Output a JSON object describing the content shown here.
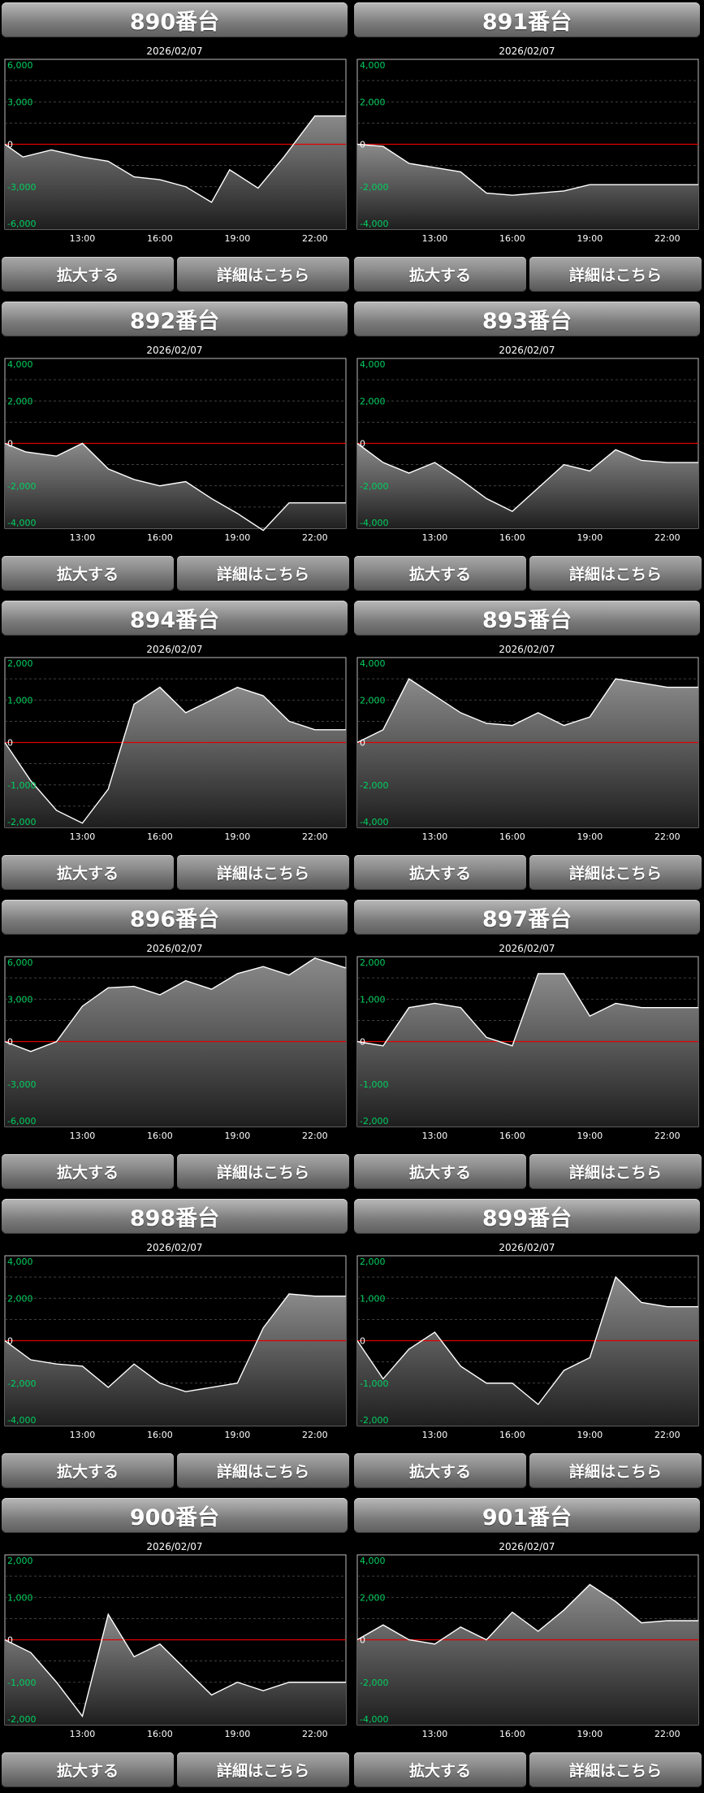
{
  "buttons": {
    "zoom_label": "拡大する",
    "detail_label": "詳細はこちら"
  },
  "colors": {
    "zero_line": "#e00000",
    "axis_label": "#00d060",
    "line": "#ffffff"
  },
  "panels": [
    {
      "title": "890番台",
      "date": "2026/02/07",
      "chart_data": {
        "type": "area",
        "y_ticks": [
          "6,000",
          "3,000",
          "0",
          "-3,000",
          "-6,000"
        ],
        "y_tick_values": [
          6000,
          3000,
          0,
          -3000,
          -6000
        ],
        "ylim": [
          -6000,
          6000
        ],
        "x_ticks": [
          "13:00",
          "16:00",
          "19:00",
          "22:00"
        ],
        "x_tick_values": [
          13,
          16,
          19,
          22
        ],
        "xlim": [
          10,
          23.2
        ],
        "x": [
          10,
          10.7,
          11.8,
          13,
          14,
          15,
          16,
          17,
          18,
          18.7,
          19.8,
          20.8,
          22,
          23,
          23.2
        ],
        "y": [
          0,
          -900,
          -400,
          -900,
          -1200,
          -2300,
          -2500,
          -3000,
          -4100,
          -1800,
          -3100,
          -900,
          2000,
          2000,
          2000
        ]
      }
    },
    {
      "title": "891番台",
      "date": "2026/02/07",
      "chart_data": {
        "type": "area",
        "y_ticks": [
          "4,000",
          "2,000",
          "0",
          "-2,000",
          "-4,000"
        ],
        "y_tick_values": [
          4000,
          2000,
          0,
          -2000,
          -4000
        ],
        "ylim": [
          -4000,
          4000
        ],
        "x_ticks": [
          "13:00",
          "16:00",
          "19:00",
          "22:00"
        ],
        "x_tick_values": [
          13,
          16,
          19,
          22
        ],
        "xlim": [
          10,
          23.2
        ],
        "x": [
          10,
          11,
          12,
          13,
          14,
          15,
          16,
          17,
          18,
          19,
          20,
          21,
          22,
          23.2
        ],
        "y": [
          0,
          -100,
          -900,
          -1100,
          -1300,
          -2300,
          -2400,
          -2300,
          -2200,
          -1900,
          -1900,
          -1900,
          -1900,
          -1900
        ]
      }
    },
    {
      "title": "892番台",
      "date": "2026/02/07",
      "chart_data": {
        "type": "area",
        "y_ticks": [
          "4,000",
          "2,000",
          "0",
          "-2,000",
          "-4,000"
        ],
        "y_tick_values": [
          4000,
          2000,
          0,
          -2000,
          -4000
        ],
        "ylim": [
          -4000,
          4000
        ],
        "x_ticks": [
          "13:00",
          "16:00",
          "19:00",
          "22:00"
        ],
        "x_tick_values": [
          13,
          16,
          19,
          22
        ],
        "xlim": [
          10,
          23.2
        ],
        "x": [
          10,
          10.8,
          12,
          13,
          14,
          15,
          16,
          17,
          18,
          19,
          20,
          21,
          22,
          23.2
        ],
        "y": [
          0,
          -400,
          -600,
          0,
          -1200,
          -1700,
          -2000,
          -1800,
          -2600,
          -3300,
          -4100,
          -2800,
          -2800,
          -2800
        ]
      }
    },
    {
      "title": "893番台",
      "date": "2026/02/07",
      "chart_data": {
        "type": "area",
        "y_ticks": [
          "4,000",
          "2,000",
          "0",
          "-2,000",
          "-4,000"
        ],
        "y_tick_values": [
          4000,
          2000,
          0,
          -2000,
          -4000
        ],
        "ylim": [
          -4000,
          4000
        ],
        "x_ticks": [
          "13:00",
          "16:00",
          "19:00",
          "22:00"
        ],
        "x_tick_values": [
          13,
          16,
          19,
          22
        ],
        "xlim": [
          10,
          23.2
        ],
        "x": [
          10,
          11,
          12,
          13,
          14,
          15,
          16,
          17,
          18,
          19,
          20,
          21,
          22,
          23.2
        ],
        "y": [
          0,
          -900,
          -1400,
          -900,
          -1700,
          -2600,
          -3200,
          -2100,
          -1000,
          -1300,
          -300,
          -800,
          -900,
          -900
        ]
      }
    },
    {
      "title": "894番台",
      "date": "2026/02/07",
      "chart_data": {
        "type": "area",
        "y_ticks": [
          "2,000",
          "1,000",
          "0",
          "-1,000",
          "-2,000"
        ],
        "y_tick_values": [
          2000,
          1000,
          0,
          -1000,
          -2000
        ],
        "ylim": [
          -2000,
          2000
        ],
        "x_ticks": [
          "13:00",
          "16:00",
          "19:00",
          "22:00"
        ],
        "x_tick_values": [
          13,
          16,
          19,
          22
        ],
        "xlim": [
          10,
          23.2
        ],
        "x": [
          10,
          11,
          12,
          13,
          14,
          15,
          16,
          17,
          18,
          19,
          20,
          21,
          22,
          23.2
        ],
        "y": [
          0,
          -900,
          -1600,
          -1900,
          -1100,
          900,
          1300,
          700,
          1000,
          1300,
          1100,
          500,
          300,
          300
        ]
      }
    },
    {
      "title": "895番台",
      "date": "2026/02/07",
      "chart_data": {
        "type": "area",
        "y_ticks": [
          "4,000",
          "2,000",
          "0",
          "-2,000",
          "-4,000"
        ],
        "y_tick_values": [
          4000,
          2000,
          0,
          -2000,
          -4000
        ],
        "ylim": [
          -4000,
          4000
        ],
        "x_ticks": [
          "13:00",
          "16:00",
          "19:00",
          "22:00"
        ],
        "x_tick_values": [
          13,
          16,
          19,
          22
        ],
        "xlim": [
          10,
          23.2
        ],
        "x": [
          10,
          11,
          12,
          13,
          14,
          15,
          16,
          17,
          18,
          19,
          20,
          21,
          22,
          23.2
        ],
        "y": [
          0,
          600,
          3000,
          2200,
          1400,
          900,
          800,
          1400,
          800,
          1200,
          3000,
          2800,
          2600,
          2600
        ]
      }
    },
    {
      "title": "896番台",
      "date": "2026/02/07",
      "chart_data": {
        "type": "area",
        "y_ticks": [
          "6,000",
          "3,000",
          "0",
          "-3,000",
          "-6,000"
        ],
        "y_tick_values": [
          6000,
          3000,
          0,
          -3000,
          -6000
        ],
        "ylim": [
          -6000,
          6000
        ],
        "x_ticks": [
          "13:00",
          "16:00",
          "19:00",
          "22:00"
        ],
        "x_tick_values": [
          13,
          16,
          19,
          22
        ],
        "xlim": [
          10,
          23.2
        ],
        "x": [
          10,
          11,
          12,
          13,
          14,
          15,
          16,
          17,
          18,
          19,
          20,
          21,
          22,
          23.2
        ],
        "y": [
          0,
          -700,
          0,
          2500,
          3800,
          3900,
          3300,
          4300,
          3700,
          4800,
          5300,
          4700,
          5900,
          5200
        ]
      }
    },
    {
      "title": "897番台",
      "date": "2026/02/07",
      "chart_data": {
        "type": "area",
        "y_ticks": [
          "2,000",
          "1,000",
          "0",
          "-1,000",
          "-2,000"
        ],
        "y_tick_values": [
          2000,
          1000,
          0,
          -1000,
          -2000
        ],
        "ylim": [
          -2000,
          2000
        ],
        "x_ticks": [
          "13:00",
          "16:00",
          "19:00",
          "22:00"
        ],
        "x_tick_values": [
          13,
          16,
          19,
          22
        ],
        "xlim": [
          10,
          23.2
        ],
        "x": [
          10,
          11,
          12,
          13,
          14,
          15,
          16,
          17,
          18,
          19,
          20,
          21,
          22,
          23.2
        ],
        "y": [
          0,
          -100,
          800,
          900,
          800,
          100,
          -100,
          1600,
          1600,
          600,
          900,
          800,
          800,
          800
        ]
      }
    },
    {
      "title": "898番台",
      "date": "2026/02/07",
      "chart_data": {
        "type": "area",
        "y_ticks": [
          "4,000",
          "2,000",
          "0",
          "-2,000",
          "-4,000"
        ],
        "y_tick_values": [
          4000,
          2000,
          0,
          -2000,
          -4000
        ],
        "ylim": [
          -4000,
          4000
        ],
        "x_ticks": [
          "13:00",
          "16:00",
          "19:00",
          "22:00"
        ],
        "x_tick_values": [
          13,
          16,
          19,
          22
        ],
        "xlim": [
          10,
          23.2
        ],
        "x": [
          10,
          11,
          12,
          13,
          14,
          15,
          16,
          17,
          18,
          19,
          20,
          21,
          22,
          23.2
        ],
        "y": [
          0,
          -900,
          -1100,
          -1200,
          -2200,
          -1100,
          -2000,
          -2400,
          -2200,
          -2000,
          600,
          2200,
          2100,
          2100
        ]
      }
    },
    {
      "title": "899番台",
      "date": "2026/02/07",
      "chart_data": {
        "type": "area",
        "y_ticks": [
          "2,000",
          "1,000",
          "0",
          "-1,000",
          "-2,000"
        ],
        "y_tick_values": [
          2000,
          1000,
          0,
          -1000,
          -2000
        ],
        "ylim": [
          -2000,
          2000
        ],
        "x_ticks": [
          "13:00",
          "16:00",
          "19:00",
          "22:00"
        ],
        "x_tick_values": [
          13,
          16,
          19,
          22
        ],
        "xlim": [
          10,
          23.2
        ],
        "x": [
          10,
          11,
          12,
          13,
          14,
          15,
          16,
          17,
          18,
          19,
          20,
          21,
          22,
          23.2
        ],
        "y": [
          0,
          -900,
          -200,
          200,
          -600,
          -1000,
          -1000,
          -1500,
          -700,
          -400,
          1500,
          900,
          800,
          800
        ]
      }
    },
    {
      "title": "900番台",
      "date": "2026/02/07",
      "chart_data": {
        "type": "area",
        "y_ticks": [
          "2,000",
          "1,000",
          "0",
          "-1,000",
          "-2,000"
        ],
        "y_tick_values": [
          2000,
          1000,
          0,
          -1000,
          -2000
        ],
        "ylim": [
          -2000,
          2000
        ],
        "x_ticks": [
          "13:00",
          "16:00",
          "19:00",
          "22:00"
        ],
        "x_tick_values": [
          13,
          16,
          19,
          22
        ],
        "xlim": [
          10,
          23.2
        ],
        "x": [
          10,
          11,
          12,
          13,
          14,
          15,
          16,
          17,
          18,
          19,
          20,
          21,
          22,
          23.2
        ],
        "y": [
          0,
          -300,
          -1000,
          -1800,
          600,
          -400,
          -100,
          -700,
          -1300,
          -1000,
          -1200,
          -1000,
          -1000,
          -1000
        ]
      }
    },
    {
      "title": "901番台",
      "date": "2026/02/07",
      "chart_data": {
        "type": "area",
        "y_ticks": [
          "4,000",
          "2,000",
          "0",
          "-2,000",
          "-4,000"
        ],
        "y_tick_values": [
          4000,
          2000,
          0,
          -2000,
          -4000
        ],
        "ylim": [
          -4000,
          4000
        ],
        "x_ticks": [
          "13:00",
          "16:00",
          "19:00",
          "22:00"
        ],
        "x_tick_values": [
          13,
          16,
          19,
          22
        ],
        "xlim": [
          10,
          23.2
        ],
        "x": [
          10,
          11,
          12,
          13,
          14,
          15,
          16,
          17,
          18,
          19,
          20,
          21,
          22,
          23.2
        ],
        "y": [
          0,
          700,
          0,
          -200,
          600,
          0,
          1300,
          400,
          1400,
          2600,
          1800,
          800,
          900,
          900
        ]
      }
    }
  ]
}
